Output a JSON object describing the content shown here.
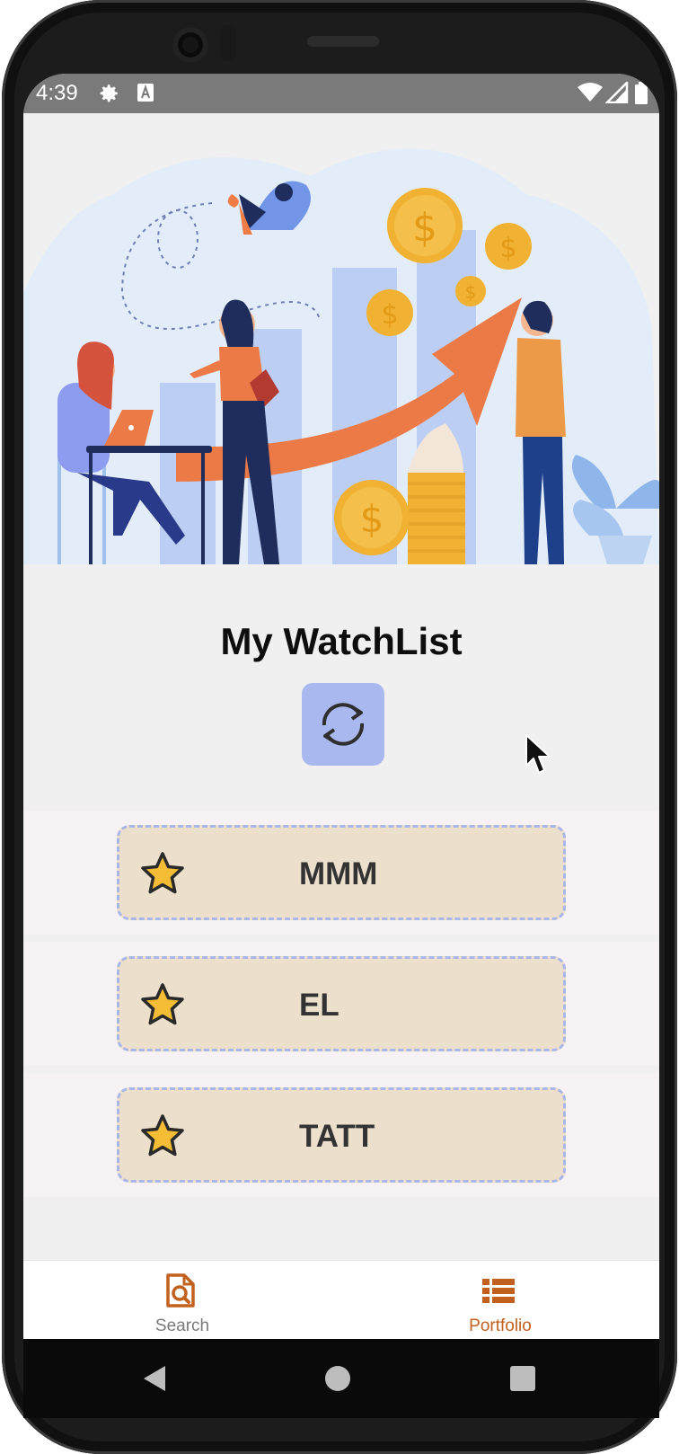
{
  "status_bar": {
    "time": "4:39",
    "icons": [
      "gear-icon",
      "a-notification-icon",
      "wifi-icon",
      "signal-icon",
      "battery-icon"
    ]
  },
  "hero": {
    "illustration": "investment-growth-illustration"
  },
  "watchlist": {
    "title": "My WatchList",
    "refresh_icon": "refresh-icon",
    "items": [
      {
        "ticker": "MMM",
        "icon": "star-icon"
      },
      {
        "ticker": "EL",
        "icon": "star-icon"
      },
      {
        "ticker": "TATT",
        "icon": "star-icon"
      }
    ]
  },
  "bottom_nav": {
    "items": [
      {
        "label": "Search",
        "icon": "search-document-icon",
        "active": false
      },
      {
        "label": "Portfolio",
        "icon": "list-icon",
        "active": true
      }
    ]
  },
  "colors": {
    "accent": "#c2601d",
    "card_bg": "#ecdfcc",
    "card_border": "#a9b7e8",
    "refresh_bg": "#a9b9ef",
    "status_bar": "#7a7a7a"
  }
}
